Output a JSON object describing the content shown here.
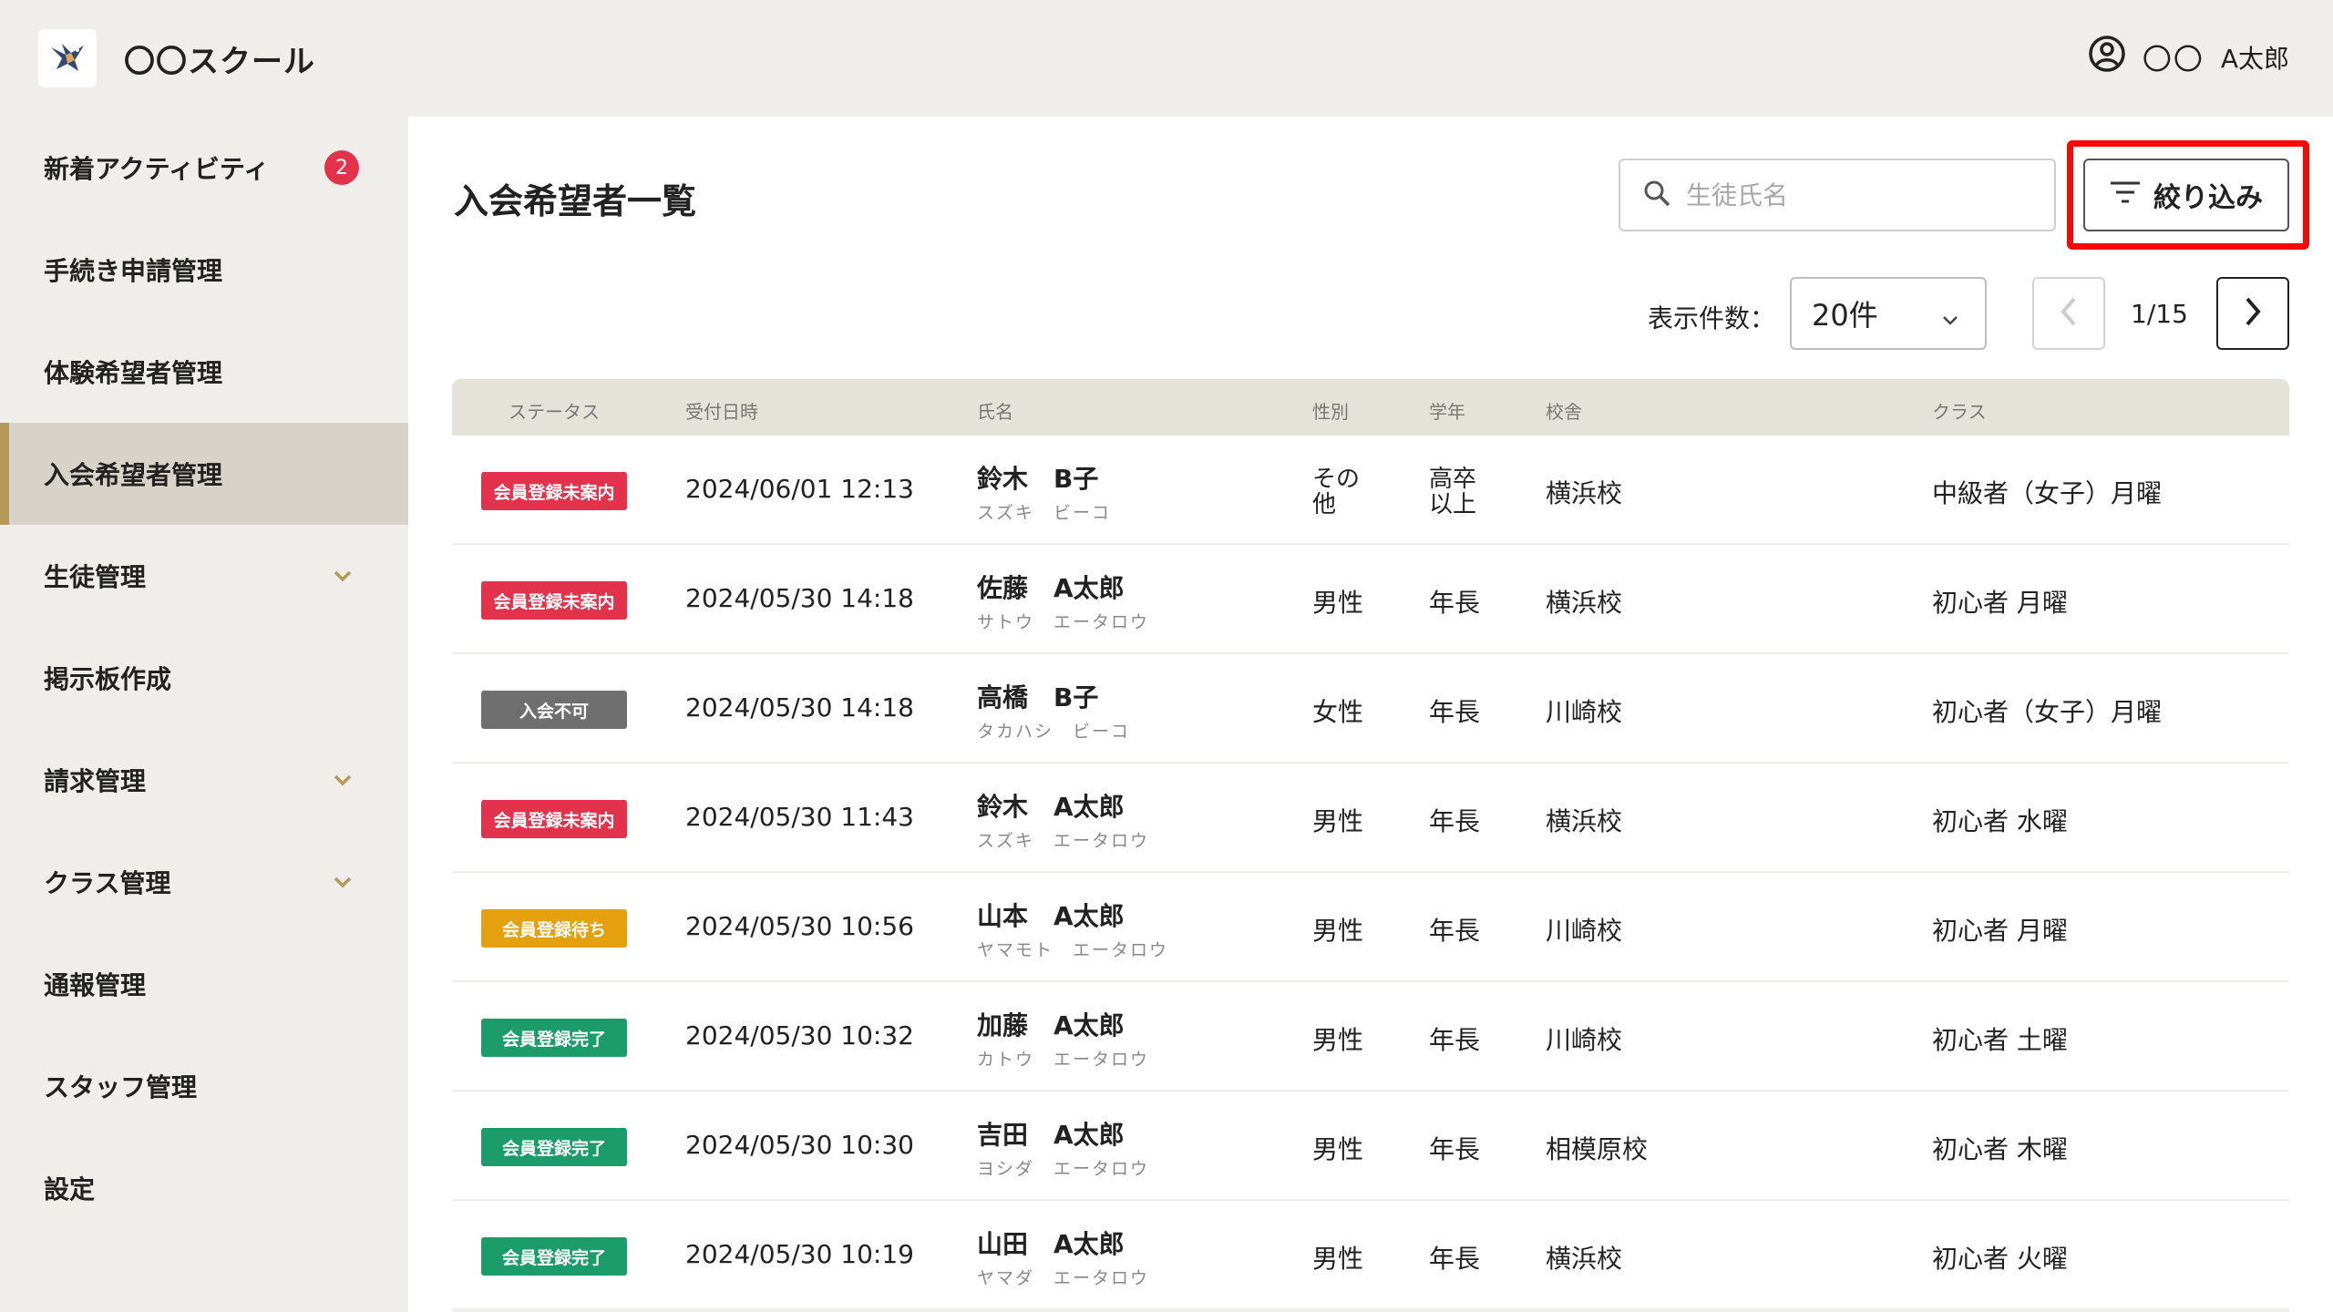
{
  "header": {
    "app_title": "〇〇スクール",
    "user_name_a": "〇〇",
    "user_name_b": "A太郎"
  },
  "sidebar": {
    "items": [
      {
        "label": "新着アクティビティ",
        "badge": "2"
      },
      {
        "label": "手続き申請管理"
      },
      {
        "label": "体験希望者管理"
      },
      {
        "label": "入会希望者管理",
        "active": true
      },
      {
        "label": "生徒管理",
        "expandable": true
      },
      {
        "label": "掲示板作成"
      },
      {
        "label": "請求管理",
        "expandable": true
      },
      {
        "label": "クラス管理",
        "expandable": true
      },
      {
        "label": "通報管理"
      },
      {
        "label": "スタッフ管理"
      },
      {
        "label": "設定"
      }
    ]
  },
  "main": {
    "title": "入会希望者一覧",
    "search_placeholder": "生徒氏名",
    "filter_label": "絞り込み",
    "perpage_label": "表示件数：",
    "perpage_value": "20件",
    "pager_text": "1/15"
  },
  "table": {
    "headers": {
      "status": "ステータス",
      "date": "受付日時",
      "name": "氏名",
      "gender": "性別",
      "grade": "学年",
      "school": "校舎",
      "klass": "クラス"
    },
    "rows": [
      {
        "status": "会員登録未案内",
        "status_color": "#e3324b",
        "date": "2024/06/01 12:13",
        "name": "鈴木　B子",
        "kana": "スズキ　ビーコ",
        "gender": "その他",
        "grade": "高卒以上",
        "school": "横浜校",
        "klass": "中級者（女子）月曜"
      },
      {
        "status": "会員登録未案内",
        "status_color": "#e3324b",
        "date": "2024/05/30 14:18",
        "name": "佐藤　A太郎",
        "kana": "サトウ　エータロウ",
        "gender": "男性",
        "grade": "年長",
        "school": "横浜校",
        "klass": "初心者 月曜"
      },
      {
        "status": "入会不可",
        "status_color": "#6f6f6f",
        "date": "2024/05/30 14:18",
        "name": "高橋　B子",
        "kana": "タカハシ　ビーコ",
        "gender": "女性",
        "grade": "年長",
        "school": "川崎校",
        "klass": "初心者（女子）月曜"
      },
      {
        "status": "会員登録未案内",
        "status_color": "#e3324b",
        "date": "2024/05/30 11:43",
        "name": "鈴木　A太郎",
        "kana": "スズキ　エータロウ",
        "gender": "男性",
        "grade": "年長",
        "school": "横浜校",
        "klass": "初心者 水曜"
      },
      {
        "status": "会員登録待ち",
        "status_color": "#e5a00d",
        "date": "2024/05/30 10:56",
        "name": "山本　A太郎",
        "kana": "ヤマモト　エータロウ",
        "gender": "男性",
        "grade": "年長",
        "school": "川崎校",
        "klass": "初心者 月曜"
      },
      {
        "status": "会員登録完了",
        "status_color": "#1c9c6a",
        "date": "2024/05/30 10:32",
        "name": "加藤　A太郎",
        "kana": "カトウ　エータロウ",
        "gender": "男性",
        "grade": "年長",
        "school": "川崎校",
        "klass": "初心者 土曜"
      },
      {
        "status": "会員登録完了",
        "status_color": "#1c9c6a",
        "date": "2024/05/30 10:30",
        "name": "吉田　A太郎",
        "kana": "ヨシダ　エータロウ",
        "gender": "男性",
        "grade": "年長",
        "school": "相模原校",
        "klass": "初心者 木曜"
      },
      {
        "status": "会員登録完了",
        "status_color": "#1c9c6a",
        "date": "2024/05/30 10:19",
        "name": "山田　A太郎",
        "kana": "ヤマダ　エータロウ",
        "gender": "男性",
        "grade": "年長",
        "school": "横浜校",
        "klass": "初心者 火曜"
      }
    ]
  },
  "icons": {
    "logo": "bird-logo-icon",
    "user": "user-circle-icon",
    "search": "search-icon",
    "filter": "filter-icon",
    "chevron": "chevron-down-icon",
    "prev": "chevron-left-icon",
    "next": "chevron-right-icon"
  },
  "colors": {
    "accent": "#b59a58",
    "badge": "#e3324b",
    "highlight": "#f40a0a"
  }
}
